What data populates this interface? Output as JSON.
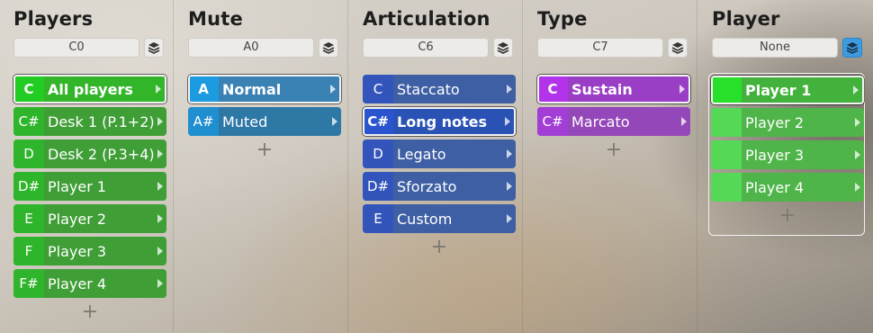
{
  "columns": [
    {
      "title": "Players",
      "note": "C0",
      "layers_active": false,
      "items": [
        {
          "key": "C",
          "label": "All players",
          "selected": true
        },
        {
          "key": "C#",
          "label": "Desk 1 (P.1+2)",
          "selected": false
        },
        {
          "key": "D",
          "label": "Desk 2 (P.3+4)",
          "selected": false
        },
        {
          "key": "D#",
          "label": "Player 1",
          "selected": false
        },
        {
          "key": "E",
          "label": "Player 2",
          "selected": false
        },
        {
          "key": "F",
          "label": "Player 3",
          "selected": false
        },
        {
          "key": "F#",
          "label": "Player 4",
          "selected": false
        }
      ],
      "add_label": "+"
    },
    {
      "title": "Mute",
      "note": "A0",
      "layers_active": false,
      "items": [
        {
          "key": "A",
          "label": "Normal",
          "selected": true
        },
        {
          "key": "A#",
          "label": "Muted",
          "selected": false
        }
      ],
      "add_label": "+"
    },
    {
      "title": "Articulation",
      "note": "C6",
      "layers_active": false,
      "items": [
        {
          "key": "C",
          "label": "Staccato",
          "selected": false
        },
        {
          "key": "C#",
          "label": "Long notes",
          "selected": true
        },
        {
          "key": "D",
          "label": "Legato",
          "selected": false
        },
        {
          "key": "D#",
          "label": "Sforzato",
          "selected": false
        },
        {
          "key": "E",
          "label": "Custom",
          "selected": false
        }
      ],
      "add_label": "+"
    },
    {
      "title": "Type",
      "note": "C7",
      "layers_active": false,
      "items": [
        {
          "key": "C",
          "label": "Sustain",
          "selected": true
        },
        {
          "key": "C#",
          "label": "Marcato",
          "selected": false
        }
      ],
      "add_label": "+"
    },
    {
      "title": "Player",
      "note": "None",
      "layers_active": true,
      "items": [
        {
          "key": "",
          "label": "Player 1",
          "selected": true
        },
        {
          "key": "",
          "label": "Player 2",
          "selected": false
        },
        {
          "key": "",
          "label": "Player 3",
          "selected": false
        },
        {
          "key": "",
          "label": "Player 4",
          "selected": false
        }
      ],
      "add_label": "+"
    }
  ],
  "colors": {
    "players": "#3f9e36",
    "mute": "#2e78a6",
    "articulation": "#3e5fa3",
    "type": "#9447b8",
    "player": "#4fb54a",
    "layers_active": "#3d9be0"
  },
  "icons": {
    "layers": "layers-icon",
    "arrow": "chevron-right-icon",
    "add": "plus-icon"
  }
}
